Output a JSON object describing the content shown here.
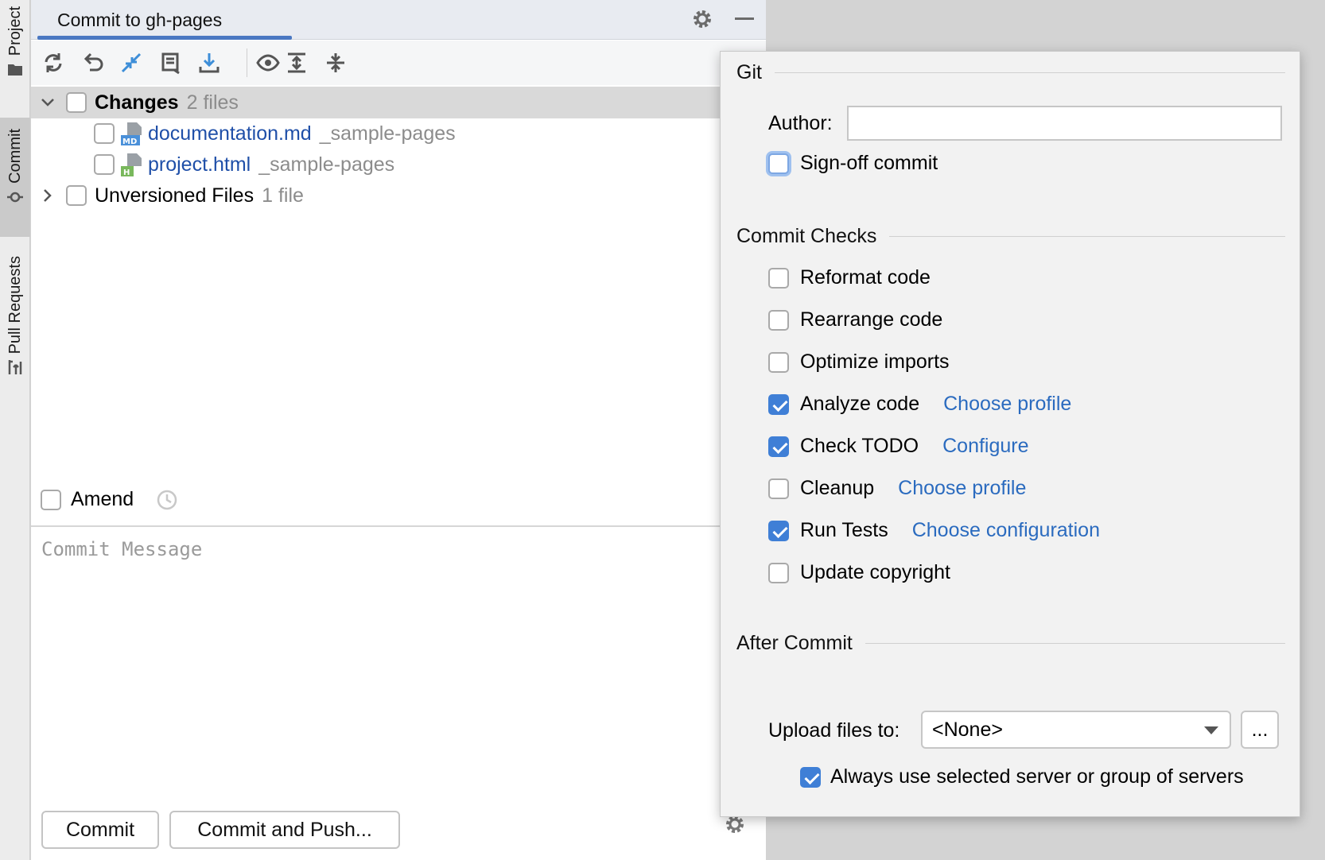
{
  "side_tabs": {
    "project": "Project",
    "commit": "Commit",
    "pull_requests": "Pull Requests"
  },
  "panel": {
    "title": "Commit to gh-pages",
    "accent_color": "#4a78c2"
  },
  "toolbar": {
    "icons": [
      "refresh-icon",
      "rollback-icon",
      "merge-icon",
      "shelve-icon",
      "update-icon",
      "eye-icon",
      "expand-all-icon",
      "collapse-all-icon"
    ]
  },
  "tree": {
    "changes": {
      "label": "Changes",
      "count": "2 files"
    },
    "files": [
      {
        "name": "documentation.md",
        "path": "_sample-pages",
        "icon": "markdown-file-icon"
      },
      {
        "name": "project.html",
        "path": "_sample-pages",
        "icon": "html-file-icon"
      }
    ],
    "unversioned": {
      "label": "Unversioned Files",
      "count": "1 file"
    }
  },
  "amend": {
    "label": "Amend",
    "checked": false
  },
  "commit_message": {
    "placeholder": "Commit Message"
  },
  "buttons": {
    "commit": "Commit",
    "commit_and_push": "Commit and Push..."
  },
  "popup": {
    "git_section": "Git",
    "author_label": "Author:",
    "author_value": "",
    "signoff": {
      "label": "Sign-off commit",
      "checked": false
    },
    "checks_section": "Commit Checks",
    "checks": [
      {
        "label": "Reformat code",
        "checked": false,
        "link": ""
      },
      {
        "label": "Rearrange code",
        "checked": false,
        "link": ""
      },
      {
        "label": "Optimize imports",
        "checked": false,
        "link": ""
      },
      {
        "label": "Analyze code",
        "checked": true,
        "link": "Choose profile"
      },
      {
        "label": "Check TODO",
        "checked": true,
        "link": "Configure"
      },
      {
        "label": "Cleanup",
        "checked": false,
        "link": "Choose profile"
      },
      {
        "label": "Run Tests",
        "checked": true,
        "link": "Choose configuration"
      },
      {
        "label": "Update copyright",
        "checked": false,
        "link": ""
      }
    ],
    "after_section": "After Commit",
    "upload_label": "Upload files to:",
    "upload_value": "<None>",
    "dots_label": "...",
    "always_use": {
      "label": "Always use selected server or group of servers",
      "checked": true
    },
    "check_color": "#3f7fd6",
    "link_color": "#2b6bbf"
  }
}
